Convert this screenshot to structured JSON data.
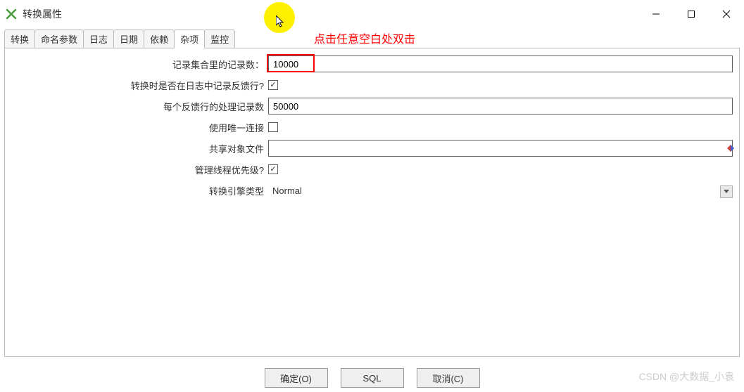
{
  "window": {
    "title": "转换属性"
  },
  "annotation": "点击任意空白处双击",
  "tabs": [
    {
      "label": "转换"
    },
    {
      "label": "命名参数"
    },
    {
      "label": "日志"
    },
    {
      "label": "日期"
    },
    {
      "label": "依赖"
    },
    {
      "label": "杂项"
    },
    {
      "label": "监控"
    }
  ],
  "form": {
    "records_in_set": {
      "label": "记录集合里的记录数：",
      "value": "10000"
    },
    "log_feedback": {
      "label": "转换时是否在日志中记录反馈行?",
      "checked": true
    },
    "feedback_records": {
      "label": "每个反馈行的处理记录数",
      "value": "50000"
    },
    "unique_connection": {
      "label": "使用唯一连接",
      "checked": false
    },
    "shared_object_file": {
      "label": "共享对象文件",
      "value": ""
    },
    "manage_thread_priority": {
      "label": "管理线程优先级?",
      "checked": true
    },
    "engine_type": {
      "label": "转换引擎类型",
      "value": "Normal"
    }
  },
  "footer": {
    "ok": "确定(O)",
    "sql": "SQL",
    "cancel": "取消(C)"
  },
  "watermark": "CSDN @大数据_小袁"
}
